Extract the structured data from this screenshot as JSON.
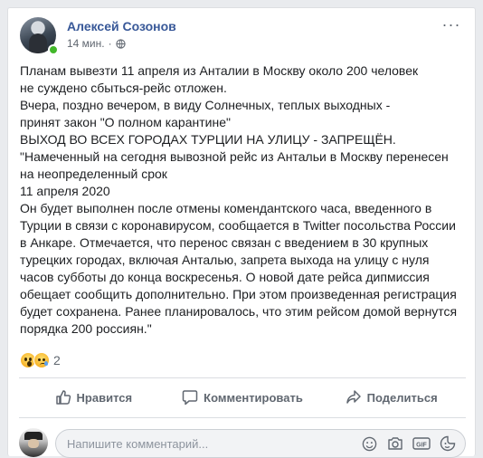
{
  "post": {
    "author": "Алексей Созонов",
    "time": "14 мин.",
    "separator": "·",
    "more_label": "···",
    "lines": [
      "Планам вывезти 11 апреля из Анталии в Москву около 200 человек",
      "не суждено сбыться-рейс отложен.",
      "Вчера, поздно вечером, в виду Солнечных, теплых выходных -",
      "принят закон \"О полном карантине\"",
      "ВЫХОД ВО ВСЕХ ГОРОДАХ ТУРЦИИ НА УЛИЦУ - ЗАПРЕЩЁН.",
      "\"Намеченный на сегодня вывозной рейс из Антальи в Москву перенесен",
      "на неопределенный срок",
      "11 апреля 2020",
      "Он будет выполнен после отмены комендантского часа, введенного в",
      "Турции в связи с коронавирусом, сообщается в Twitter посольства России",
      "в Анкаре. Отмечается, что перенос связан с введением в 30 крупных",
      "турецких городах, включая Анталью, запрета выхода на улицу с нуля",
      "часов субботы до конца воскресенья. О новой дате рейса дипмиссия",
      "обещает сообщить дополнительно. При этом произведенная регистрация",
      "будет сохранена. Ранее планировалось, что этим рейсом домой вернутся",
      "порядка 200 россиян.\""
    ]
  },
  "reactions": {
    "types": [
      "wow",
      "sad"
    ],
    "count": "2"
  },
  "actions": {
    "like": "Нравится",
    "comment": "Комментировать",
    "share": "Поделиться"
  },
  "comment_box": {
    "placeholder": "Напишите комментарий...",
    "icons": [
      "emoji-icon",
      "camera-icon",
      "gif-icon",
      "sticker-icon"
    ]
  },
  "colors": {
    "author": "#385898",
    "online": "#42b72a",
    "secondary_text": "#606770",
    "background": "#e9ebee"
  }
}
